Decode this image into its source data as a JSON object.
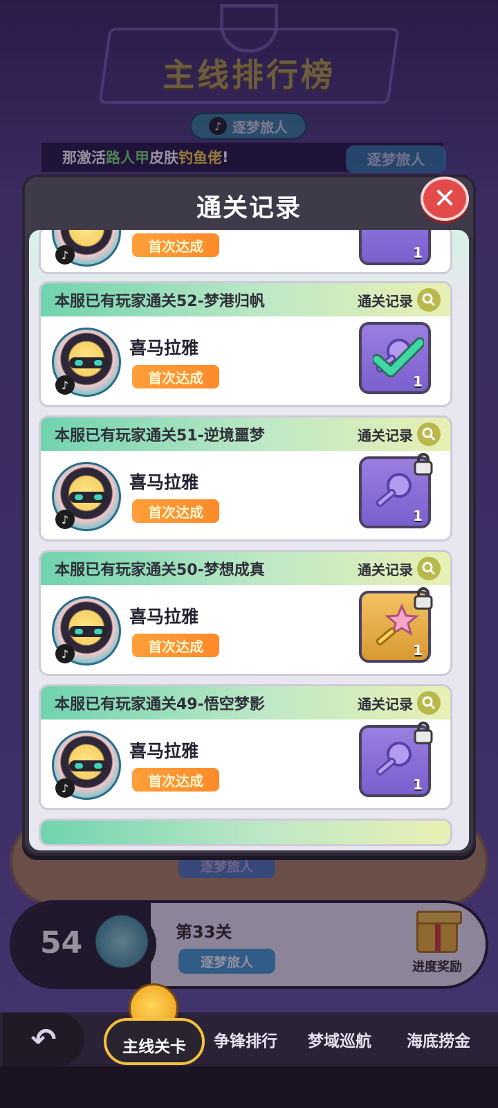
{
  "background": {
    "title": "主线排行榜",
    "top_nickname": "逐梦旅人",
    "marquee": {
      "prefix": "那激活",
      "highlight1": "路人甲",
      "middle": "皮肤",
      "highlight2": "钓鱼佬",
      "suffix": "!"
    },
    "marquee_nickname": "逐梦旅人",
    "ranking_row": {
      "rank": "54",
      "level": "第33关",
      "nickname": "逐梦旅人",
      "reward_label": "进度奖励"
    },
    "gold_row_nickname": "逐梦旅人"
  },
  "modal": {
    "title": "通关记录",
    "close_icon": "close-x",
    "partial_top": {
      "first_clear_label": "首次达成",
      "key_count": "1"
    },
    "records": [
      {
        "header": "本服已有玩家通关52-梦港归帆",
        "record_link": "通关记录",
        "player_name": "喜马拉雅",
        "first_clear_label": "首次达成",
        "key_type": "purple-key-checked",
        "key_count": "1"
      },
      {
        "header": "本服已有玩家通关51-逆境噩梦",
        "record_link": "通关记录",
        "player_name": "喜马拉雅",
        "first_clear_label": "首次达成",
        "key_type": "purple-key-locked",
        "key_count": "1"
      },
      {
        "header": "本服已有玩家通关50-梦想成真",
        "record_link": "通关记录",
        "player_name": "喜马拉雅",
        "first_clear_label": "首次达成",
        "key_type": "gold-star-key-locked",
        "key_count": "1"
      },
      {
        "header": "本服已有玩家通关49-悟空梦影",
        "record_link": "通关记录",
        "player_name": "喜马拉雅",
        "first_clear_label": "首次达成",
        "key_type": "purple-key-locked",
        "key_count": "1"
      }
    ]
  },
  "bottom_nav": {
    "back_icon": "back-arrow",
    "tabs": [
      {
        "label": "主线关卡",
        "active": true
      },
      {
        "label": "争锋排行",
        "active": false
      },
      {
        "label": "梦域巡航",
        "active": false
      },
      {
        "label": "海底捞金",
        "active": false
      }
    ]
  },
  "colors": {
    "accent_gold": "#f3c13b",
    "close_red": "#e34b4b",
    "first_clear_orange": "#ff9f3a",
    "header_green": "#6fd3ad"
  }
}
